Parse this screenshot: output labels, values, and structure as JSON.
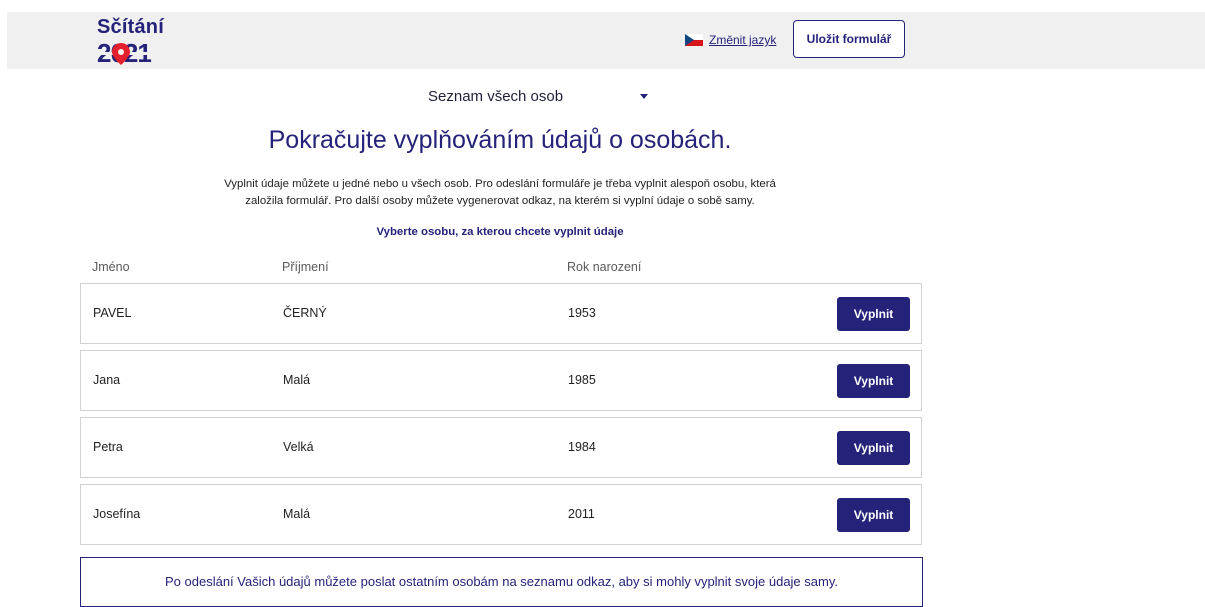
{
  "header": {
    "logo": {
      "word": "Sčítání",
      "year": "2021",
      "colors": {
        "navy": "#25227a",
        "red": "#e4202e"
      }
    },
    "language_label": "Změnit jazyk",
    "flag_icon": "czech-flag-icon",
    "save_label": "Uložit formulář"
  },
  "person_select": {
    "label": "Seznam všech osob",
    "icon": "caret-down-icon"
  },
  "main": {
    "title": "Pokračujte vyplňováním údajů o osobách.",
    "intro_line1": "Vyplnit údaje můžete u jedné nebo u všech osob. Pro odeslání formuláře je třeba vyplnit alespoň osobu, která",
    "intro_line2": "založila formulář. Pro další osoby můžete vygenerovat odkaz, na kterém si vyplní údaje o sobě samy.",
    "select_prompt": "Vyberte osobu, za kterou chcete vyplnit údaje"
  },
  "table": {
    "columns": [
      "Jméno",
      "Příjmení",
      "Rok narození"
    ],
    "rows": [
      {
        "name": "PAVEL",
        "surname": "ČERNÝ",
        "year": "1953",
        "action": "Vyplnit"
      },
      {
        "name": "Jana",
        "surname": "Malá",
        "year": "1985",
        "action": "Vyplnit"
      },
      {
        "name": "Petra",
        "surname": "Velká",
        "year": "1984",
        "action": "Vyplnit"
      },
      {
        "name": "Josefína",
        "surname": "Malá",
        "year": "2011",
        "action": "Vyplnit"
      }
    ]
  },
  "info_box": {
    "text": "Po odeslání Vašich údajů můžete poslat ostatním osobám na seznamu odkaz, aby si mohly vyplnit svoje údaje samy."
  },
  "colors": {
    "accent": "#25227a",
    "header_background": "#f0f0f0",
    "row_border": "#d2d2d2"
  }
}
